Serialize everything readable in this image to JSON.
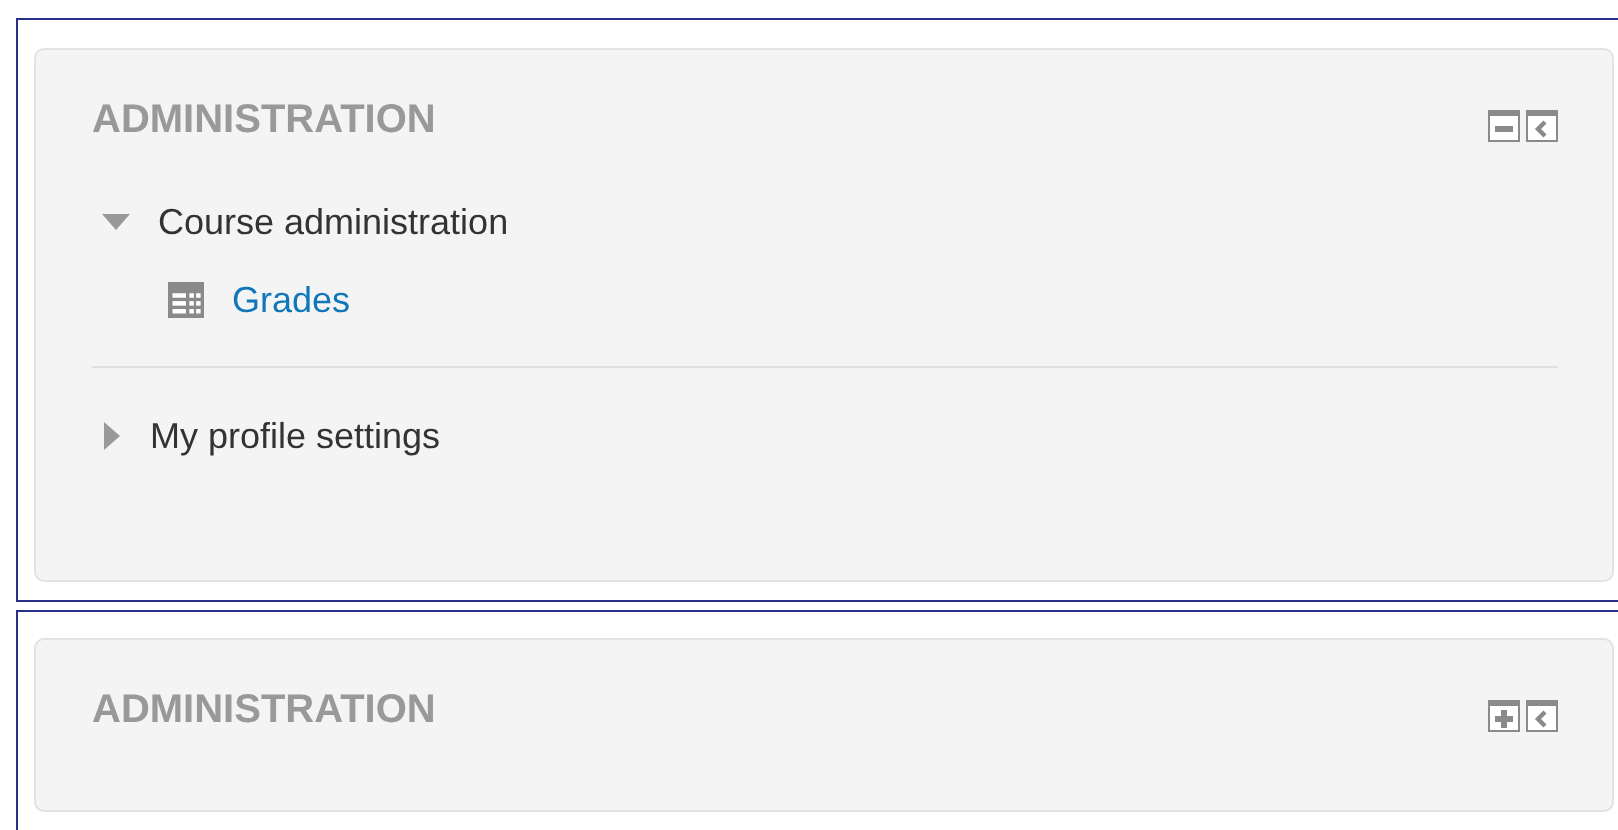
{
  "blocks": [
    {
      "title": "ADMINISTRATION",
      "collapsed": false,
      "items": [
        {
          "label": "Course administration",
          "expanded": true,
          "children": [
            {
              "label": "Grades",
              "kind": "link"
            }
          ]
        },
        {
          "label": "My profile settings",
          "expanded": false
        }
      ]
    },
    {
      "title": "ADMINISTRATION",
      "collapsed": true
    }
  ]
}
